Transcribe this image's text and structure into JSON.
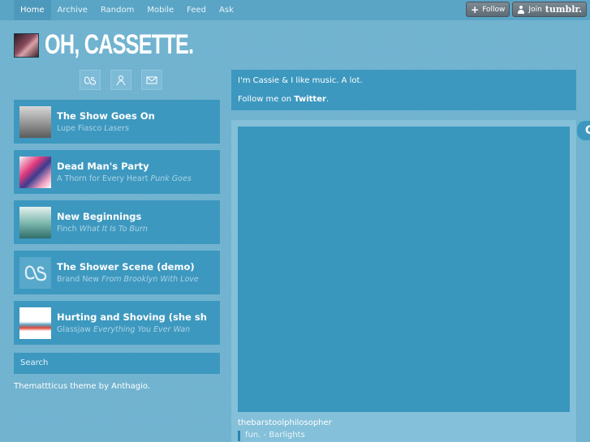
{
  "nav": {
    "items": [
      "Home",
      "Archive",
      "Random",
      "Mobile",
      "Feed",
      "Ask"
    ],
    "active": "Home"
  },
  "tumblr_controls": {
    "follow_label": "Follow",
    "join_label": "Join",
    "join_brand": "tumblr."
  },
  "blog": {
    "title": "OH, CASSETTE."
  },
  "social_icons": [
    "lastfm-icon",
    "people-icon",
    "mail-icon"
  ],
  "tracks": [
    {
      "title": "The Show Goes On",
      "artist": "Lupe Fiasco",
      "album": "Lasers",
      "thumb": "lasers-cover"
    },
    {
      "title": "Dead Man's Party",
      "artist": "A Thorn for Every Heart",
      "album": "Punk Goes",
      "thumb": "punk-goes-cover"
    },
    {
      "title": "New Beginnings",
      "artist": "Finch",
      "album": "What It Is To Burn",
      "thumb": "finch-cover"
    },
    {
      "title": "The Shower Scene (demo)",
      "artist": "Brand New",
      "album": "From Brooklyn With Love",
      "thumb": "lastfm-placeholder"
    },
    {
      "title": "Hurting and Shoving (she sh",
      "artist": "Glassjaw",
      "album": "Everything You Ever Wan",
      "thumb": "glassjaw-cover"
    }
  ],
  "search": {
    "placeholder": "Search"
  },
  "credit": "Themattticus theme by Anthagio.",
  "about": {
    "line1": "I'm Cassie & I like music. A lot.",
    "line2_prefix": "Follow me on ",
    "line2_link": "Twitter",
    "line2_suffix": "."
  },
  "post": {
    "poster": "thebarstoolphilosopher",
    "quote": "fun. - Barlights"
  },
  "side_tab": "C",
  "colors": {
    "background": "#6fb2cf",
    "panel": "#3d98bf",
    "nav": "#5aa5c6",
    "nav_active": "#4d99bb"
  }
}
